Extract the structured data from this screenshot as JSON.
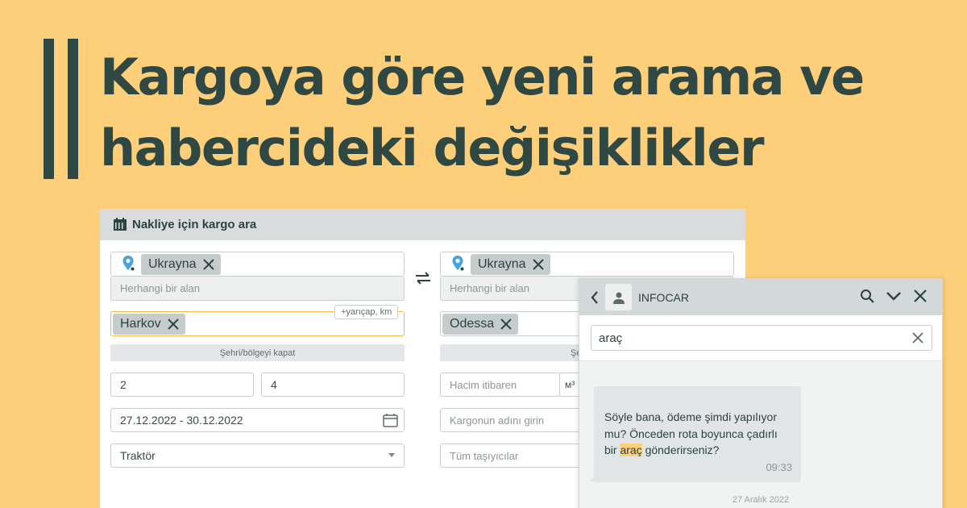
{
  "headline": {
    "line1": "Kargoya göre yeni arama ve",
    "line2": "habercideki değişiklikler"
  },
  "panel": {
    "title": "Nakliye için kargo ara",
    "from": {
      "country": "Ukrayna",
      "area_placeholder": "Herhangi bir alan",
      "city": "Harkov",
      "radius_label": "+yarıçap, km",
      "close_label": "Şehri/bölgeyi kapat",
      "weight_from": "2",
      "weight_to": "4",
      "dates": "27.12.2022 - 30.12.2022",
      "vehicle": "Traktör"
    },
    "to": {
      "country": "Ukrayna",
      "area_placeholder": "Herhangi bir alan",
      "city": "Odessa",
      "close_label": "Şehri/bö",
      "volume_placeholder": "Hacim itibaren",
      "volume_unit": "м³",
      "cargo_placeholder": "Kargonun adını girin",
      "carriers_placeholder": "Tüm taşıyıcılar"
    }
  },
  "chat": {
    "contact": "INFOCAR",
    "search_value": "araç",
    "message": {
      "before": "Söyle bana, ödeme şimdi yapılıyor mu? Önceden rota boyunca çadırlı bir ",
      "highlight": "araç",
      "after": " gönderirseniz?",
      "time": "09:33"
    },
    "date": "27 Aralık 2022"
  },
  "colors": {
    "background": "#fdcf7b",
    "dark": "#2f4843",
    "accent_pin": "#4aa3df",
    "highlight": "#fdcf7b"
  }
}
